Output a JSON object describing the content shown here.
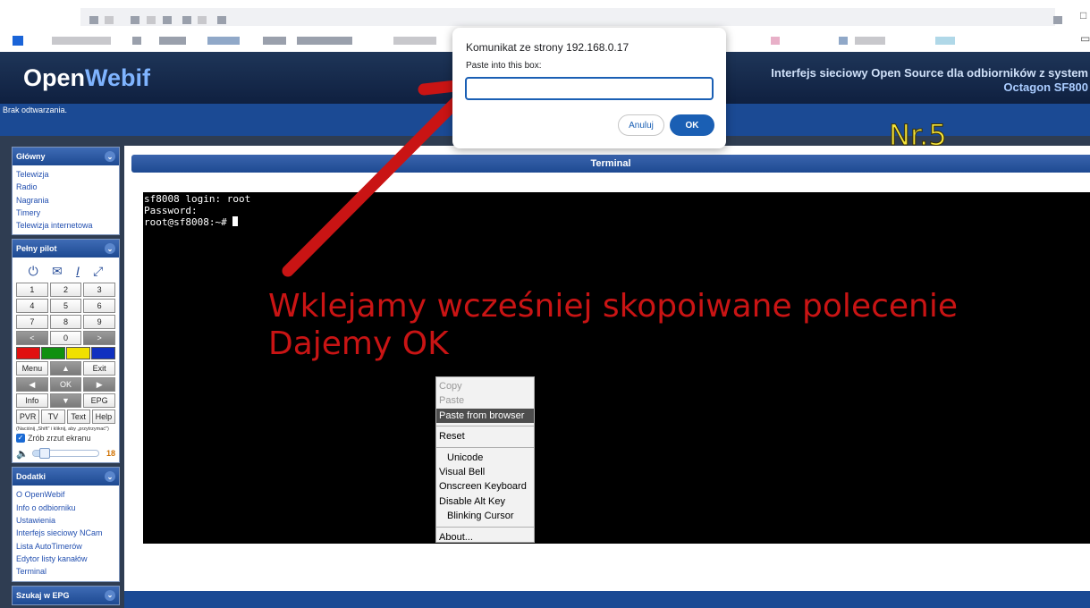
{
  "header": {
    "logo_open": "Open",
    "logo_webif": "Webif",
    "subtitle_line1": "Interfejs sieciowy Open Source dla odbiorników z system",
    "subtitle_line2": "Octagon SF800"
  },
  "status": {
    "text": "Brak odtwarzania."
  },
  "sidebar": {
    "main": {
      "title": "Główny",
      "links": [
        "Telewizja",
        "Radio",
        "Nagrania",
        "Timery",
        "Telewizja internetowa"
      ]
    },
    "remote": {
      "title": "Pełny pilot",
      "keys_num": [
        "1",
        "2",
        "3",
        "4",
        "5",
        "6",
        "7",
        "8",
        "9",
        "<",
        "0",
        ">"
      ],
      "keys_nav": [
        "Menu",
        "▲",
        "Exit",
        "◀",
        "OK",
        "▶",
        "Info",
        "▼",
        "EPG"
      ],
      "keys_func": [
        "PVR",
        "TV",
        "Text",
        "Help"
      ],
      "color_keys": [
        "#e01010",
        "#109010",
        "#f0e000",
        "#1030c0"
      ],
      "hint": "(Naciśnij „Shift\" i kliknij, aby „przytrzymać\")",
      "screenshot_label": "Zrób zrzut ekranu",
      "volume": 18,
      "volume_fraction": 0.18
    },
    "addons": {
      "title": "Dodatki",
      "links": [
        "O OpenWebif",
        "Info o odbiorniku",
        "Ustawienia",
        "Interfejs sieciowy NCam",
        "Lista AutoTimerów",
        "Edytor listy kanałów",
        "Terminal"
      ]
    },
    "epg": {
      "title": "Szukaj w EPG"
    }
  },
  "terminal": {
    "title": "Terminal",
    "line1": "sf8008 login: root",
    "line2": "Password:",
    "prompt": "root@sf8008:~# "
  },
  "context_menu": {
    "items": [
      "Copy",
      "Paste",
      "Paste from browser",
      "Reset",
      "Unicode",
      "Visual Bell",
      "Onscreen Keyboard",
      "Disable Alt Key",
      "Blinking Cursor",
      "About..."
    ]
  },
  "dialog": {
    "title": "Komunikat ze strony 192.168.0.17",
    "label": "Paste into this box:",
    "input_value": "",
    "cancel_label": "Anuluj",
    "ok_label": "OK"
  },
  "annotation": {
    "line1": "Wklejamy wcześniej skopoiwane polecenie",
    "line2": "Dajemy OK",
    "step": "Nr.5"
  },
  "colors": {
    "header": "#0f2040",
    "status_bar": "#1b4a94",
    "accent": "#1a5fb4",
    "annotation": "#c91414",
    "step": "#f4e33a"
  }
}
